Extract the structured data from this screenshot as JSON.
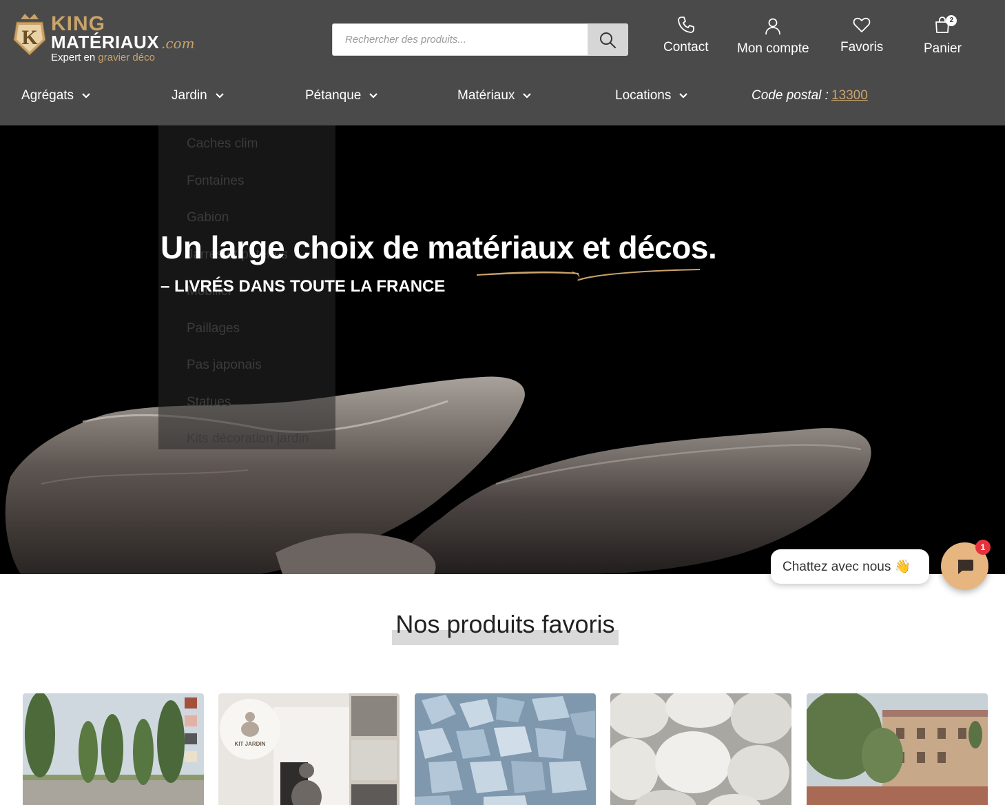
{
  "brand": {
    "badge_letter": "K",
    "name_top": "KING",
    "name_bottom": "MATÉRIAUX",
    "domain_suffix": ".com",
    "tagline_prefix": "Expert en",
    "tagline_accent": "gravier déco"
  },
  "search": {
    "placeholder": "Rechercher des produits..."
  },
  "header_links": {
    "contact": "Contact",
    "account": "Mon compte",
    "favorites": "Favoris",
    "cart": "Panier",
    "cart_count": "2"
  },
  "nav": {
    "items": [
      {
        "label": "Agrégats"
      },
      {
        "label": "Jardin"
      },
      {
        "label": "Pétanque"
      },
      {
        "label": "Matériaux"
      },
      {
        "label": "Locations"
      }
    ],
    "postal_label": "Code postal :",
    "postal_code": "13300"
  },
  "jardin_menu": {
    "items": [
      {
        "label": "Caches clim"
      },
      {
        "label": "Fontaines"
      },
      {
        "label": "Gabion"
      },
      {
        "label": "Jarres et poteries"
      },
      {
        "label": "Mobilier"
      },
      {
        "label": "Paillages"
      },
      {
        "label": "Pas japonais"
      },
      {
        "label": "Statues"
      },
      {
        "label": "Kits décoration jardin"
      }
    ]
  },
  "hero": {
    "title": "Un large choix de matériaux et décos.",
    "subtitle": "– LIVRÉS DANS TOUTE LA FRANCE"
  },
  "chat": {
    "label": "Chattez avec nous 👋",
    "badge": "1"
  },
  "favorites_section": {
    "title": "Nos produits favoris",
    "kit_label": "KIT JARDIN"
  },
  "colors": {
    "header_bg": "#4a4a4a",
    "gold_accent": "#c9a36a",
    "hero_bg": "#000000",
    "chat_button": "#e7b57f",
    "badge_red": "#e8323b"
  }
}
